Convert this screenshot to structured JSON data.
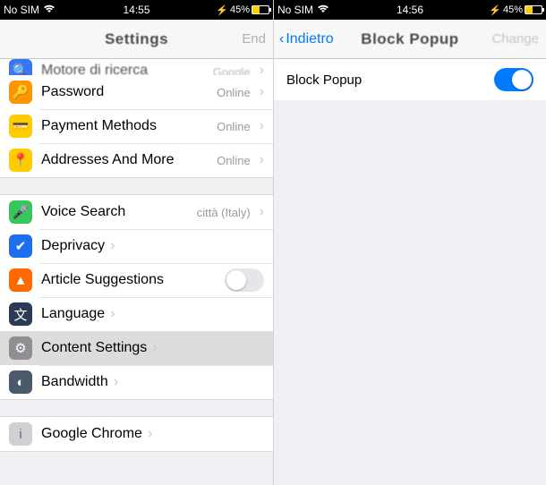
{
  "left": {
    "status": {
      "carrier": "No SIM",
      "time": "14:55",
      "battery": "45%"
    },
    "nav": {
      "title": "Settings",
      "right": "End"
    },
    "group1": [
      {
        "icon": "search-engine-icon",
        "bg": "bg-blue",
        "glyph": "🔍",
        "label": "Motore di ricerca",
        "value": "Google",
        "chevron": true,
        "partial": true
      },
      {
        "icon": "key-icon",
        "bg": "bg-orange",
        "glyph": "🔑",
        "label": "Password",
        "value": "Online",
        "chevron": true
      },
      {
        "icon": "card-icon",
        "bg": "bg-yellow",
        "glyph": "💳",
        "label": "Payment Methods",
        "value": "Online",
        "chevron": true
      },
      {
        "icon": "location-icon",
        "bg": "bg-yellow",
        "glyph": "📍",
        "label": "Addresses And More",
        "value": "Online",
        "chevron": true
      }
    ],
    "group2": [
      {
        "icon": "mic-icon",
        "bg": "bg-green",
        "glyph": "🎤",
        "label": "Voice Search",
        "value": "città (Italy)",
        "chevron": true
      },
      {
        "icon": "shield-icon",
        "bg": "bg-blue2",
        "glyph": "✔",
        "label": "Deprivacy",
        "value": "",
        "chevron": true
      },
      {
        "icon": "flame-icon",
        "bg": "bg-orange2",
        "glyph": "▲",
        "label": "Article Suggestions",
        "toggle": "off"
      },
      {
        "icon": "translate-icon",
        "bg": "bg-darkblue",
        "glyph": "文",
        "label": "Language",
        "value": "",
        "chevron": true
      },
      {
        "icon": "gear-icon",
        "bg": "bg-gray",
        "glyph": "⚙",
        "label": "Content Settings",
        "value": "",
        "chevron": true,
        "selected": true
      },
      {
        "icon": "gauge-icon",
        "bg": "bg-slate",
        "glyph": "◐",
        "label": "Bandwidth",
        "value": "",
        "chevron": true
      }
    ],
    "group3": [
      {
        "icon": "info-icon",
        "bg": "bg-lgray",
        "glyph": "i",
        "label": "Google Chrome",
        "value": "",
        "chevron": true
      }
    ]
  },
  "right": {
    "status": {
      "carrier": "No SIM",
      "time": "14:56",
      "battery": "45%"
    },
    "nav": {
      "back": "Indietro",
      "title": "Block Popup",
      "right": "Change"
    },
    "rows": [
      {
        "label": "Block Popup",
        "toggle": "on"
      }
    ]
  }
}
